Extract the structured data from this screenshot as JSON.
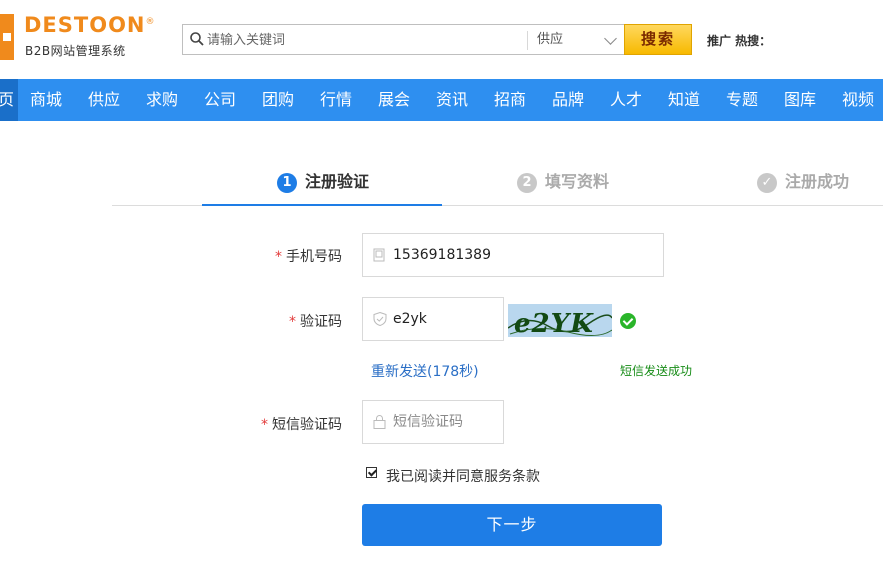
{
  "header": {
    "logo_text": "DESTOON",
    "logo_reg": "®",
    "logo_sub": "B2B网站管理系统",
    "search": {
      "placeholder": "请输入关键词",
      "category": "供应",
      "button_label": "搜索"
    },
    "hot_label": "推广 热搜："
  },
  "nav": {
    "items": [
      "页",
      "商城",
      "供应",
      "求购",
      "公司",
      "团购",
      "行情",
      "展会",
      "资讯",
      "招商",
      "品牌",
      "人才",
      "知道",
      "专题",
      "图库",
      "视频"
    ]
  },
  "steps": [
    {
      "num": "1",
      "label": "注册验证"
    },
    {
      "num": "2",
      "label": "填写资料"
    },
    {
      "num": "✓",
      "label": "注册成功"
    }
  ],
  "form": {
    "required_mark": "*",
    "phone": {
      "label": "手机号码",
      "value": "15369181389"
    },
    "captcha": {
      "label": "验证码",
      "value": "e2yk",
      "image_text": "e2YK"
    },
    "resend_label": "重新发送(178秒)",
    "sms_status": "短信发送成功",
    "sms_code": {
      "label": "短信验证码",
      "placeholder": "短信验证码"
    },
    "agree_label": "我已阅读并同意服务条款",
    "next_label": "下一步"
  },
  "colors": {
    "brand": "#f08a1c",
    "nav_bg": "#2e8ff0",
    "primary": "#1e7de6",
    "success": "#2ab52a"
  }
}
